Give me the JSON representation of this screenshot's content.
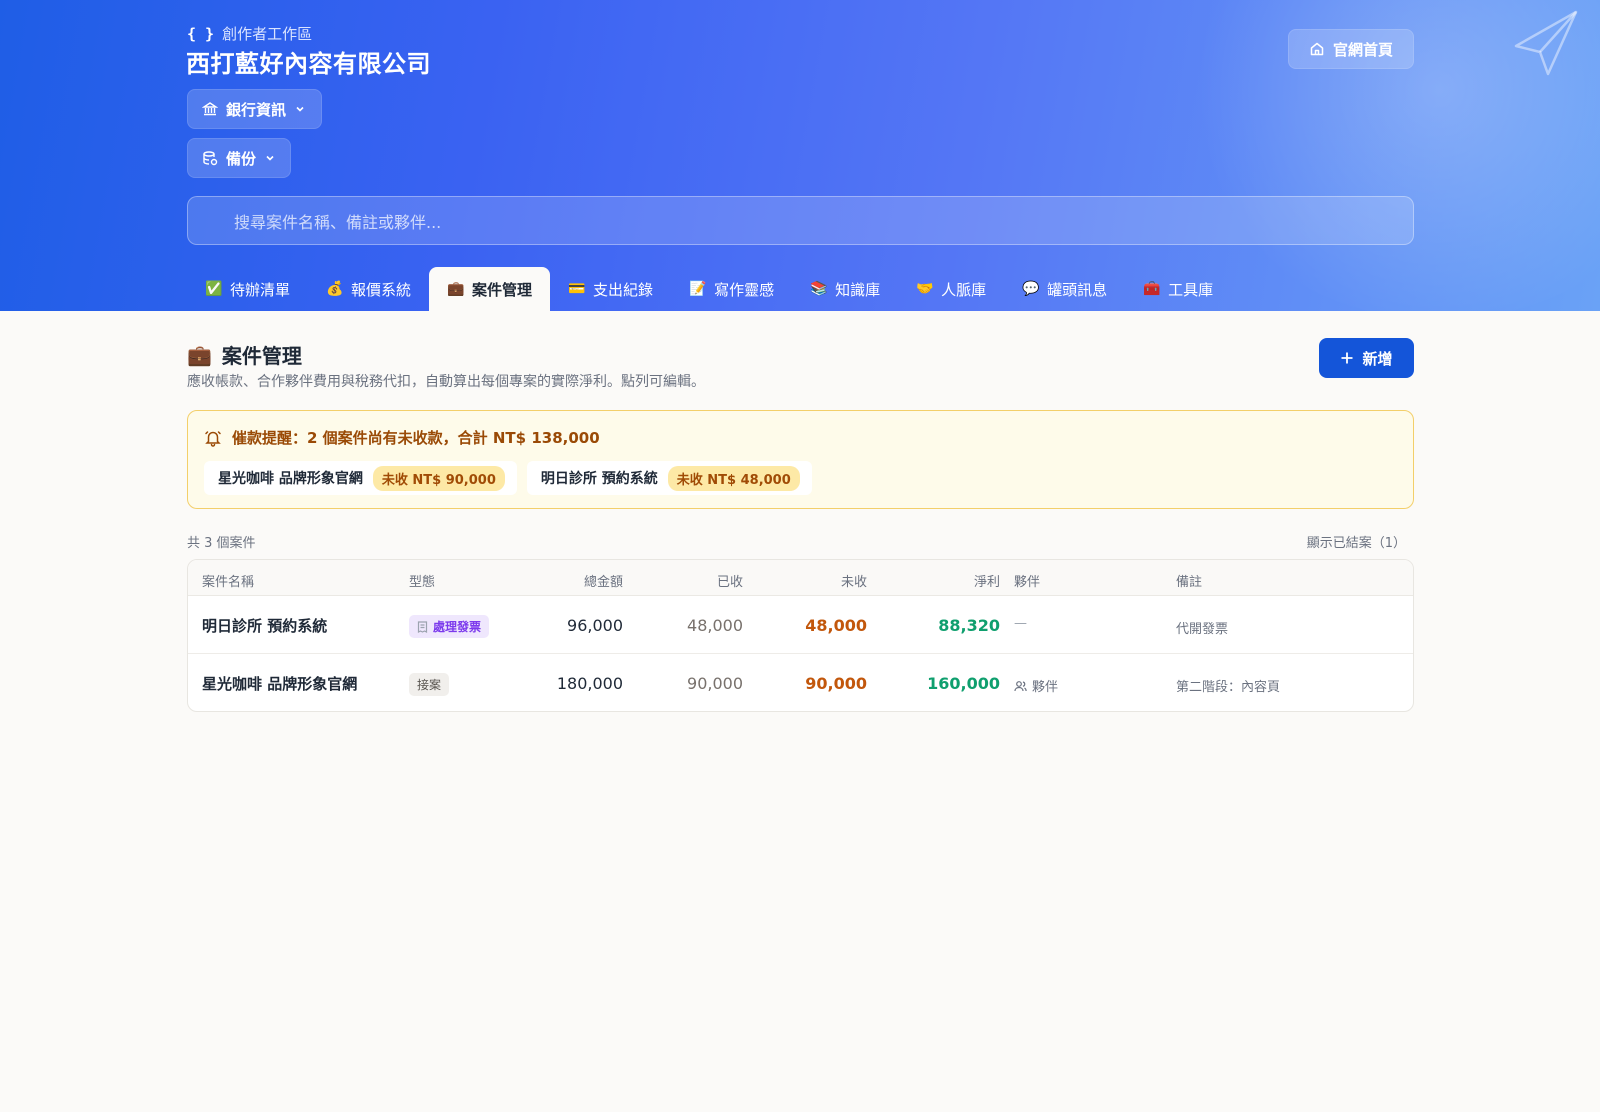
{
  "header": {
    "eyebrow_icon": "{ }",
    "eyebrow": "創作者工作區",
    "company": "西打藍好內容有限公司",
    "bank_button": "銀行資訊",
    "backup_button": "備份",
    "home_button": "官網首頁",
    "search_placeholder": "搜尋案件名稱、備註或夥伴..."
  },
  "tabs": [
    {
      "icon": "✅",
      "label": "待辦清單"
    },
    {
      "icon": "💰",
      "label": "報價系統"
    },
    {
      "icon": "💼",
      "label": "案件管理",
      "active": true
    },
    {
      "icon": "💳",
      "label": "支出紀錄"
    },
    {
      "icon": "📝",
      "label": "寫作靈感"
    },
    {
      "icon": "📚",
      "label": "知識庫"
    },
    {
      "icon": "🤝",
      "label": "人脈庫"
    },
    {
      "icon": "💬",
      "label": "罐頭訊息"
    },
    {
      "icon": "🧰",
      "label": "工具庫"
    }
  ],
  "section": {
    "icon": "💼",
    "title": "案件管理",
    "description": "應收帳款、合作夥伴費用與稅務代扣，自動算出每個專案的實際淨利。點列可編輯。",
    "add_button": "新增"
  },
  "alert": {
    "title": "催款提醒：2 個案件尚有未收款，合計 NT$ 138,000",
    "items": [
      {
        "name": "星光咖啡 品牌形象官網",
        "due": "未收 NT$ 90,000"
      },
      {
        "name": "明日診所 預約系統",
        "due": "未收 NT$ 48,000"
      }
    ]
  },
  "list": {
    "count": "共 3 個案件",
    "show_closed": "顯示已結案（1）",
    "columns": [
      "案件名稱",
      "型態",
      "總金額",
      "已收",
      "未收",
      "淨利",
      "夥伴",
      "備註"
    ],
    "rows": [
      {
        "name": "明日診所 預約系統",
        "type": "處理發票",
        "type_icon": "receipt-icon",
        "total": "96,000",
        "received": "48,000",
        "unpaid": "48,000",
        "net": "88,320",
        "partner": "—",
        "note": "代開發票"
      },
      {
        "name": "星光咖啡 品牌形象官網",
        "type": "接案",
        "total": "180,000",
        "received": "90,000",
        "unpaid": "90,000",
        "net": "160,000",
        "partner": "夥伴",
        "partner_icon": "users-icon",
        "note": "第二階段：內容頁"
      }
    ]
  },
  "colors": {
    "primary": "#1455d9",
    "unpaid": "#c2570c",
    "net": "#0f9f6e",
    "alert_bg": "#fefbea",
    "alert_border": "#f3cf6a"
  }
}
